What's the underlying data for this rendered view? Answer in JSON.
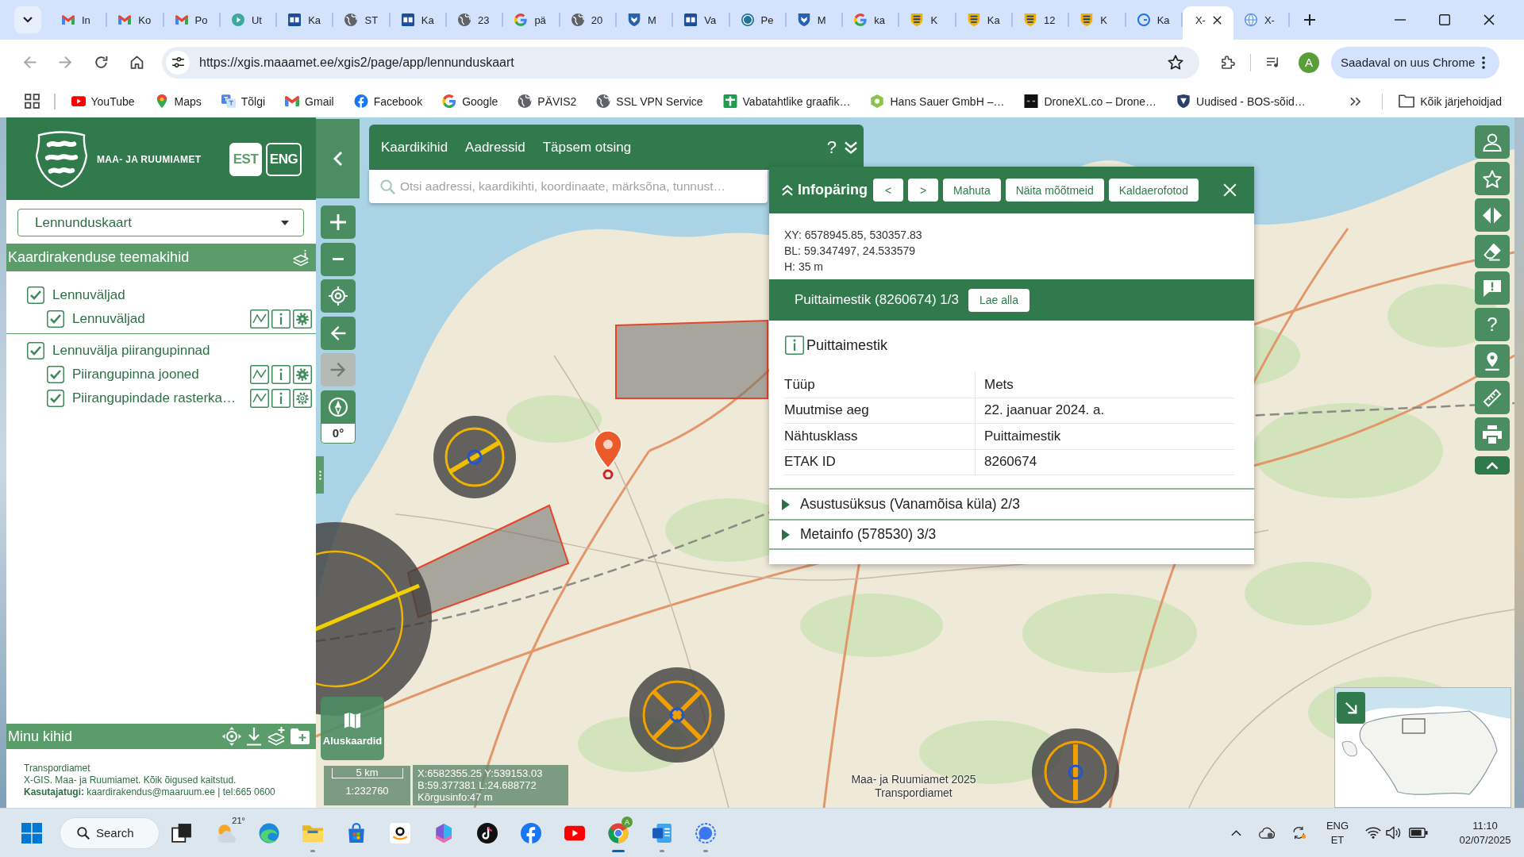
{
  "browser": {
    "tabs": [
      {
        "label": "In",
        "selected": false
      },
      {
        "label": "Ko",
        "selected": false
      },
      {
        "label": "Po",
        "selected": false
      },
      {
        "label": "Ut",
        "selected": false
      },
      {
        "label": "Ka",
        "selected": false
      },
      {
        "label": "ST",
        "selected": false
      },
      {
        "label": "Ka",
        "selected": false
      },
      {
        "label": "23",
        "selected": false
      },
      {
        "label": "pä",
        "selected": false
      },
      {
        "label": "20",
        "selected": false
      },
      {
        "label": "M",
        "selected": false
      },
      {
        "label": "Va",
        "selected": false
      },
      {
        "label": "Pe",
        "selected": false
      },
      {
        "label": "M",
        "selected": false
      },
      {
        "label": "ka",
        "selected": false
      },
      {
        "label": "K",
        "selected": false
      },
      {
        "label": "Ka",
        "selected": false
      },
      {
        "label": "12",
        "selected": false
      },
      {
        "label": "K",
        "selected": false
      },
      {
        "label": "Ka",
        "selected": false
      },
      {
        "label": "X-",
        "selected": true
      },
      {
        "label": "X-",
        "selected": false
      }
    ],
    "history_buttons": [
      {
        "disabled": true
      },
      {
        "disabled": true
      }
    ],
    "address": "https://xgis.maaamet.ee/xgis2/page/app/lennunduskaart",
    "profile": "A",
    "update_button": "Saadaval on uus Chrome",
    "bookmarks": [
      "YouTube",
      "Maps",
      "Tõlgi",
      "Gmail",
      "Facebook",
      "Google",
      "PÄVIS2",
      "SSL VPN Service",
      "Vabatahtlike graafik…",
      "Hans Sauer GmbH –…",
      "DroneXL.co – Drone…",
      "Uudised - BOS-sõid…"
    ],
    "all_bookmarks": "Kõik järjehoidjad"
  },
  "sidebar": {
    "org_name": "MAA- JA RUUMIAMET",
    "languages": [
      {
        "label": "EST",
        "selected": true
      },
      {
        "label": "ENG",
        "selected": false
      }
    ],
    "map_select": "Lennunduskaart",
    "layers_title": "Kaardirakenduse teemakihid",
    "layers": [
      {
        "label": "Lennuväljad",
        "kind": "group",
        "checked": true,
        "children": [
          {
            "label": "Lennuväljad",
            "kind": "layer",
            "checked": true,
            "settings_active": true
          }
        ]
      },
      {
        "label": "Lennuvälja piirangupinnad",
        "kind": "group",
        "checked": true,
        "children": [
          {
            "label": "Piirangupinna jooned",
            "kind": "layer",
            "checked": true,
            "settings_active": true
          },
          {
            "label": "Piirangupindade rasterka…",
            "kind": "layer",
            "checked": true,
            "settings_active": false
          }
        ]
      }
    ],
    "my_layers_title": "Minu kihid",
    "footer": [
      "Transpordiamet",
      "X-GIS. Maa- ja Ruumiamet. Kõik õigused kaitstud.",
      "**Kasutajatugi:** kaardirakendus@maaruum.ee | tel:665 0600"
    ]
  },
  "map": {
    "search": {
      "tabs": [
        "Kaardikihid",
        "Aadressid",
        "Täpsem otsing"
      ],
      "help": "?",
      "placeholder": "Otsi aadressi, kaardikihti, koordinaate, märksõna, tunnust…"
    },
    "nav_buttons": [
      {
        "disabled": false
      },
      {
        "disabled": true
      }
    ],
    "rotation": "0°",
    "tools_help": "?",
    "base_maps": "Aluskaardid",
    "scale": {
      "distance": "5 km",
      "ratio": "1:232760"
    },
    "cursor": [
      "X:6582355.25 Y:539153.03",
      "B:59.377381 L:24.688772",
      "Kõrgusinfo:47 m"
    ],
    "attribution": [
      "Maa- ja Ruumiamet 2025",
      "Transpordiamet"
    ]
  },
  "info": {
    "title": "Infopäring",
    "buttons": [
      "<",
      ">",
      "Mahuta",
      "Näita mõõtmeid",
      "Kaldaerofotod"
    ],
    "coordinates": [
      "XY: 6578945.85, 530357.83",
      "BL: 59.347497, 24.533579",
      "H: 35 m"
    ],
    "results": [
      {
        "title": "Puittaimestik (8260674) 1/3",
        "expanded": true,
        "download": "Lae alla",
        "heading": "Puittaimestik",
        "rows": [
          {
            "label": "Tüüp",
            "value": "Mets"
          },
          {
            "label": "Muutmise aeg",
            "value": "22. jaanuar 2024. a."
          },
          {
            "label": "Nähtusklass",
            "value": "Puittaimestik"
          },
          {
            "label": "ETAK ID",
            "value": "8260674"
          }
        ]
      },
      {
        "title": "Asustusüksus (Vanamõisa küla) 2/3",
        "expanded": false
      },
      {
        "title": "Metainfo (578530) 3/3",
        "expanded": false
      }
    ]
  },
  "taskbar": {
    "search": "Search",
    "weather": "21°",
    "apps": [
      {
        "running": false,
        "selected": false
      },
      {
        "running": false,
        "selected": false
      },
      {
        "running": true,
        "selected": false
      },
      {
        "running": false,
        "selected": false
      },
      {
        "running": false,
        "selected": false
      },
      {
        "running": false,
        "selected": false
      },
      {
        "running": false,
        "selected": false
      },
      {
        "running": false,
        "selected": false
      },
      {
        "running": false,
        "selected": false
      },
      {
        "running": true,
        "selected": true
      },
      {
        "running": true,
        "selected": false
      },
      {
        "running": true,
        "selected": false
      }
    ],
    "chrome_badge": "A",
    "language": [
      "ENG",
      "ET"
    ],
    "time": "11:10",
    "date": "02/07/2025"
  }
}
